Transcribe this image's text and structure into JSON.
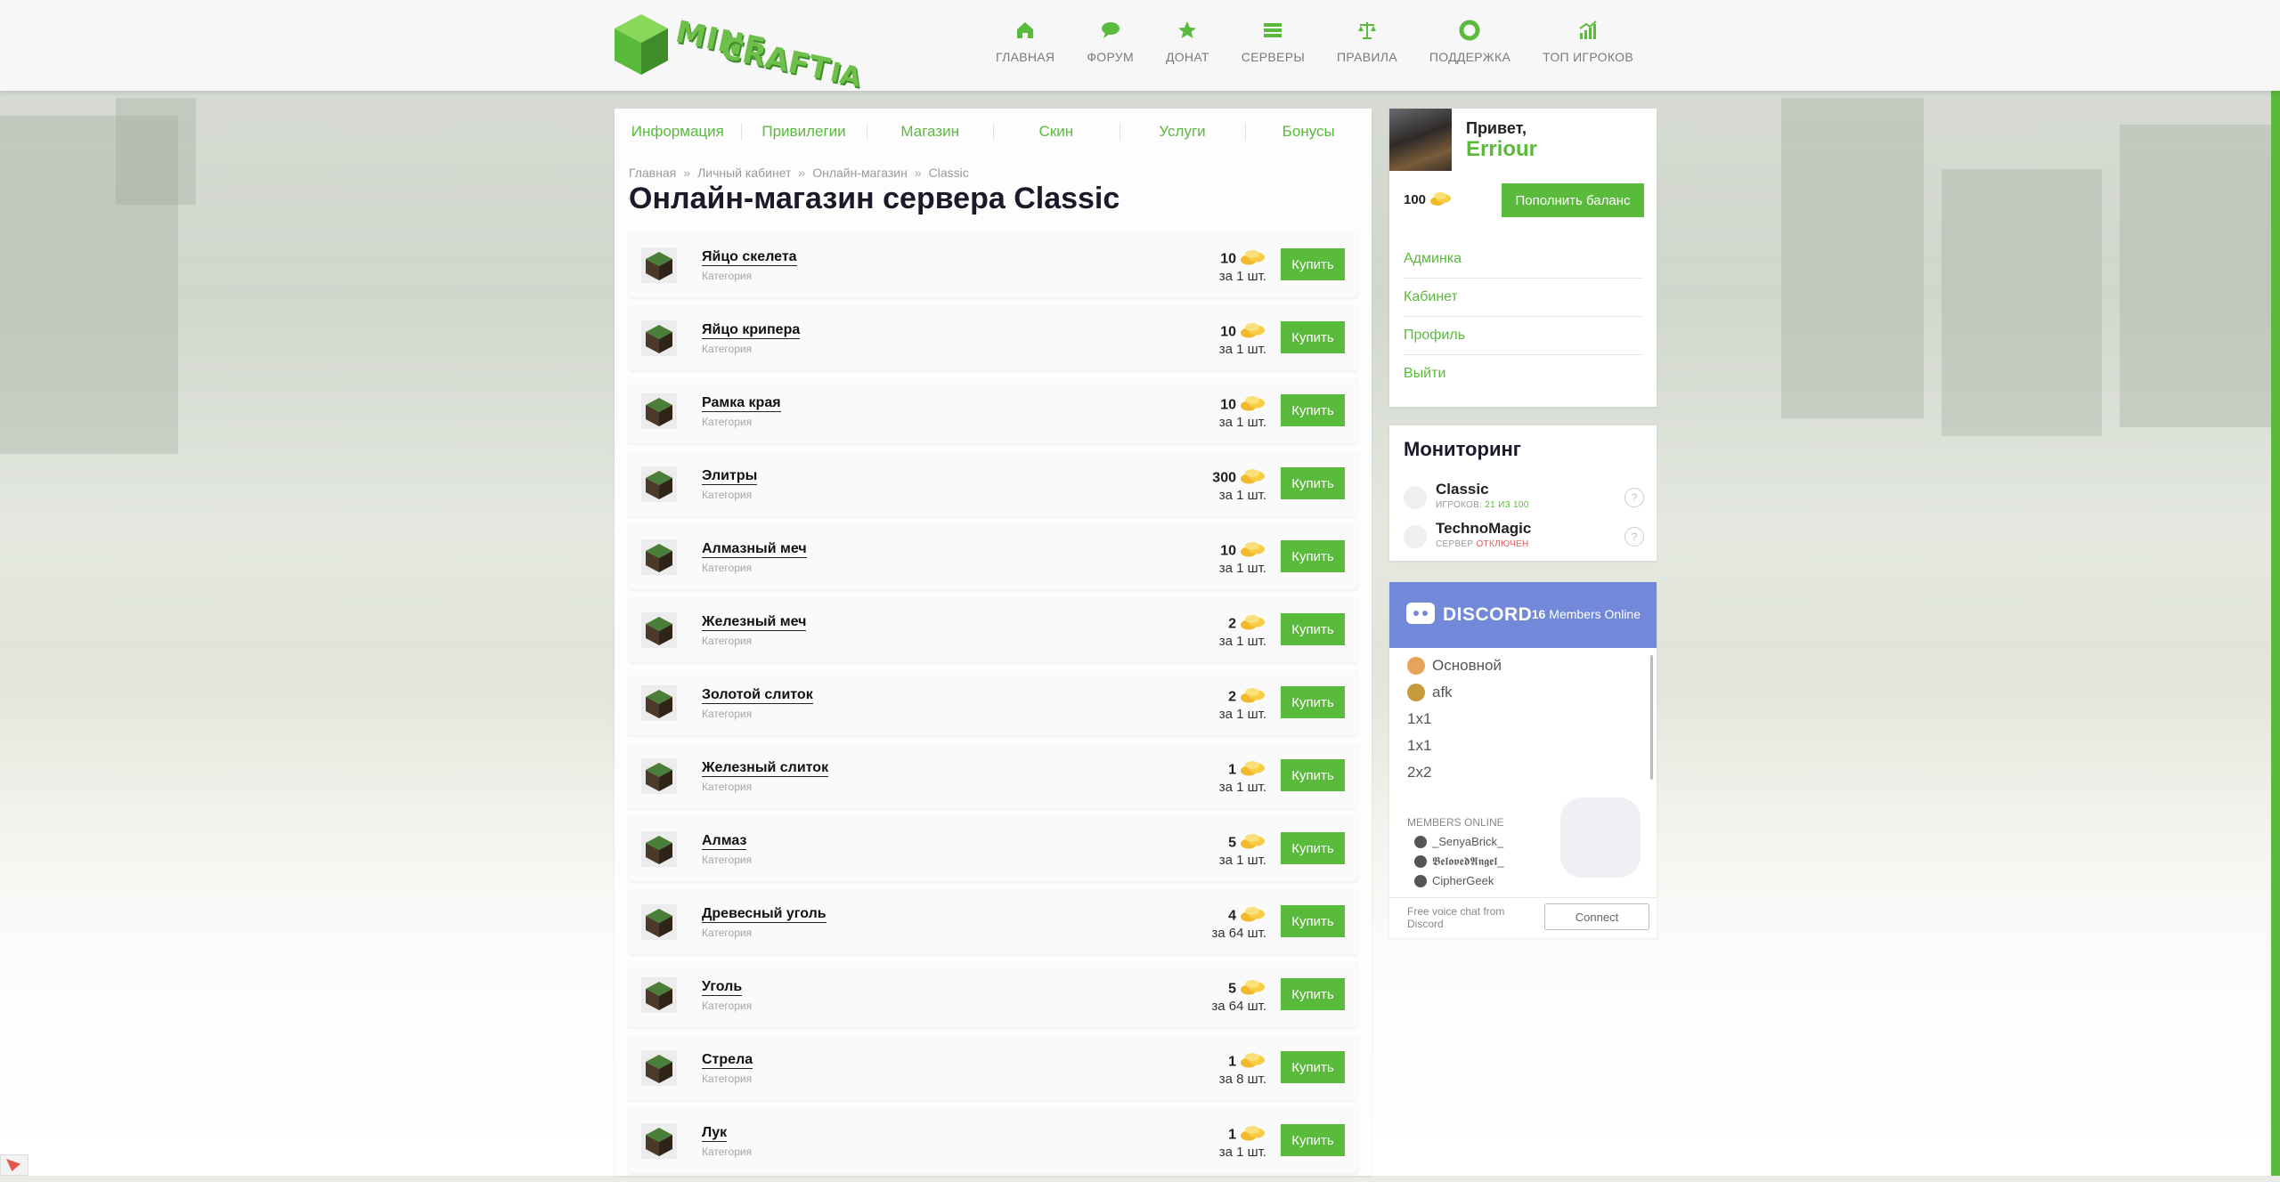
{
  "brand": {
    "logo_top": "MINE",
    "logo_bottom": "CRAFT",
    "logo_suffix": "IA",
    "accent": "#5aba3c"
  },
  "nav": [
    {
      "label": "ГЛАВНАЯ",
      "icon": "home-icon"
    },
    {
      "label": "ФОРУМ",
      "icon": "chat-icon"
    },
    {
      "label": "ДОНАТ",
      "icon": "star-icon"
    },
    {
      "label": "СЕРВЕРЫ",
      "icon": "server-list-icon"
    },
    {
      "label": "ПРАВИЛА",
      "icon": "scales-icon"
    },
    {
      "label": "ПОДДЕРЖКА",
      "icon": "lifebuoy-icon"
    },
    {
      "label": "ТОП ИГРОКОВ",
      "icon": "bar-chart-icon"
    }
  ],
  "tabs": [
    "Информация",
    "Привилегии",
    "Магазин",
    "Скин",
    "Услуги",
    "Бонусы"
  ],
  "breadcrumbs": [
    "Главная",
    "Личный кабинет",
    "Онлайн-магазин",
    "Classic"
  ],
  "page_title": "Онлайн-магазин сервера Classic",
  "buy_label": "Купить",
  "items": [
    {
      "name": "Яйцо скелета",
      "category": "Категория",
      "price": "10",
      "per": "за 1 шт."
    },
    {
      "name": "Яйцо крипера",
      "category": "Категория",
      "price": "10",
      "per": "за 1 шт."
    },
    {
      "name": "Рамка края",
      "category": "Категория",
      "price": "10",
      "per": "за 1 шт."
    },
    {
      "name": "Элитры",
      "category": "Категория",
      "price": "300",
      "per": "за 1 шт."
    },
    {
      "name": "Алмазный меч",
      "category": "Категория",
      "price": "10",
      "per": "за 1 шт."
    },
    {
      "name": "Железный меч",
      "category": "Категория",
      "price": "2",
      "per": "за 1 шт."
    },
    {
      "name": "Золотой слиток",
      "category": "Категория",
      "price": "2",
      "per": "за 1 шт."
    },
    {
      "name": "Железный слиток",
      "category": "Категория",
      "price": "1",
      "per": "за 1 шт."
    },
    {
      "name": "Алмаз",
      "category": "Категория",
      "price": "5",
      "per": "за 1 шт."
    },
    {
      "name": "Древесный уголь",
      "category": "Категория",
      "price": "4",
      "per": "за 64 шт."
    },
    {
      "name": "Уголь",
      "category": "Категория",
      "price": "5",
      "per": "за 64 шт."
    },
    {
      "name": "Стрела",
      "category": "Категория",
      "price": "1",
      "per": "за 8 шт."
    },
    {
      "name": "Лук",
      "category": "Категория",
      "price": "1",
      "per": "за 1 шт."
    }
  ],
  "user": {
    "greeting": "Привет,",
    "name": "Erriour",
    "balance": "100",
    "topup_label": "Пополнить баланс",
    "menu": [
      "Админка",
      "Кабинет",
      "Профиль",
      "Выйти"
    ]
  },
  "monitoring": {
    "title": "Мониторинг",
    "servers": [
      {
        "name": "Classic",
        "status_prefix": "ИГРОКОВ:",
        "status_value": "21 ИЗ 100",
        "status_color": "#5aba3c"
      },
      {
        "name": "TechnoMagic",
        "status_prefix": "СЕРВЕР",
        "status_value": "ОТКЛЮЧЕН",
        "status_color": "#e05a5a"
      }
    ]
  },
  "discord": {
    "title": "DISCORD",
    "online_count": "16",
    "online_label": "Members Online",
    "channels": [
      "Основной",
      "afk",
      "1x1",
      "1x1",
      "2x2"
    ],
    "members_header": "MEMBERS ONLINE",
    "members": [
      "_SenyaBrick_",
      "𝕭𝖊𝖑𝖔𝖛𝖊𝖉𝕬𝖓𝖌𝖊𝖑_",
      "CipherGeek"
    ],
    "footer_text": "Free voice chat from Discord",
    "connect_label": "Connect",
    "brand_color": "#7289da"
  }
}
